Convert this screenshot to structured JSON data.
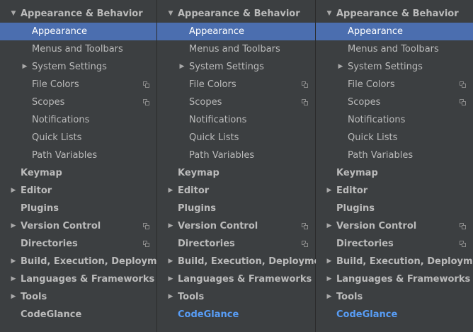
{
  "panes": [
    {
      "items": [
        {
          "label": "Appearance & Behavior",
          "level": "top",
          "arrow": "expanded"
        },
        {
          "label": "Appearance",
          "level": "child",
          "selected": true
        },
        {
          "label": "Menus and Toolbars",
          "level": "child"
        },
        {
          "label": "System Settings",
          "level": "child",
          "arrow": "collapsed"
        },
        {
          "label": "File Colors",
          "level": "child",
          "copy_icon": true
        },
        {
          "label": "Scopes",
          "level": "child",
          "copy_icon": true
        },
        {
          "label": "Notifications",
          "level": "child"
        },
        {
          "label": "Quick Lists",
          "level": "child"
        },
        {
          "label": "Path Variables",
          "level": "child"
        },
        {
          "label": "Keymap",
          "level": "top"
        },
        {
          "label": "Editor",
          "level": "top",
          "arrow": "collapsed"
        },
        {
          "label": "Plugins",
          "level": "top"
        },
        {
          "label": "Version Control",
          "level": "top",
          "arrow": "collapsed",
          "copy_icon": true
        },
        {
          "label": "Directories",
          "level": "top",
          "copy_icon": true
        },
        {
          "label": "Build, Execution, Deployment",
          "level": "top",
          "arrow": "collapsed"
        },
        {
          "label": "Languages & Frameworks",
          "level": "top",
          "arrow": "collapsed"
        },
        {
          "label": "Tools",
          "level": "top",
          "arrow": "collapsed"
        },
        {
          "label": "CodeGlance",
          "level": "top"
        }
      ]
    },
    {
      "items": [
        {
          "label": "Appearance & Behavior",
          "level": "top",
          "arrow": "expanded"
        },
        {
          "label": "Appearance",
          "level": "child",
          "selected": true
        },
        {
          "label": "Menus and Toolbars",
          "level": "child"
        },
        {
          "label": "System Settings",
          "level": "child",
          "arrow": "collapsed"
        },
        {
          "label": "File Colors",
          "level": "child",
          "copy_icon": true
        },
        {
          "label": "Scopes",
          "level": "child",
          "copy_icon": true
        },
        {
          "label": "Notifications",
          "level": "child"
        },
        {
          "label": "Quick Lists",
          "level": "child"
        },
        {
          "label": "Path Variables",
          "level": "child"
        },
        {
          "label": "Keymap",
          "level": "top"
        },
        {
          "label": "Editor",
          "level": "top",
          "arrow": "collapsed"
        },
        {
          "label": "Plugins",
          "level": "top"
        },
        {
          "label": "Version Control",
          "level": "top",
          "arrow": "collapsed",
          "copy_icon": true
        },
        {
          "label": "Directories",
          "level": "top",
          "copy_icon": true
        },
        {
          "label": "Build, Execution, Deployment",
          "level": "top",
          "arrow": "collapsed"
        },
        {
          "label": "Languages & Frameworks",
          "level": "top",
          "arrow": "collapsed"
        },
        {
          "label": "Tools",
          "level": "top",
          "arrow": "collapsed"
        },
        {
          "label": "CodeGlance",
          "level": "top",
          "link": true
        }
      ]
    },
    {
      "items": [
        {
          "label": "Appearance & Behavior",
          "level": "top",
          "arrow": "expanded"
        },
        {
          "label": "Appearance",
          "level": "child",
          "selected": true
        },
        {
          "label": "Menus and Toolbars",
          "level": "child"
        },
        {
          "label": "System Settings",
          "level": "child",
          "arrow": "collapsed"
        },
        {
          "label": "File Colors",
          "level": "child",
          "copy_icon": true
        },
        {
          "label": "Scopes",
          "level": "child",
          "copy_icon": true
        },
        {
          "label": "Notifications",
          "level": "child"
        },
        {
          "label": "Quick Lists",
          "level": "child"
        },
        {
          "label": "Path Variables",
          "level": "child"
        },
        {
          "label": "Keymap",
          "level": "top"
        },
        {
          "label": "Editor",
          "level": "top",
          "arrow": "collapsed"
        },
        {
          "label": "Plugins",
          "level": "top"
        },
        {
          "label": "Version Control",
          "level": "top",
          "arrow": "collapsed",
          "copy_icon": true
        },
        {
          "label": "Directories",
          "level": "top",
          "copy_icon": true
        },
        {
          "label": "Build, Execution, Deployment",
          "level": "top",
          "arrow": "collapsed"
        },
        {
          "label": "Languages & Frameworks",
          "level": "top",
          "arrow": "collapsed"
        },
        {
          "label": "Tools",
          "level": "top",
          "arrow": "collapsed"
        },
        {
          "label": "CodeGlance",
          "level": "top",
          "link": true
        }
      ]
    }
  ],
  "icons": {
    "expanded": "arrow-down-icon",
    "collapsed": "arrow-right-icon",
    "copy": "copy-settings-icon"
  },
  "colors": {
    "background": "#3c3f41",
    "selection": "#4b6eaf",
    "text": "#bbbbbb",
    "link": "#589df6"
  }
}
